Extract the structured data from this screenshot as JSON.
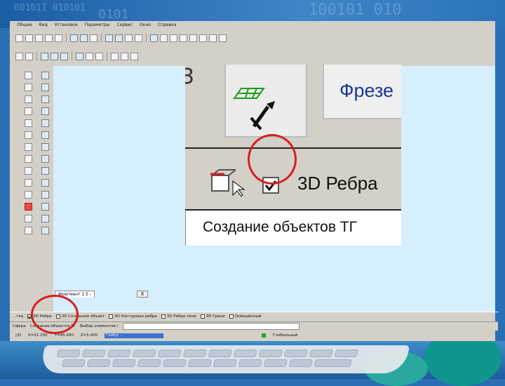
{
  "menu": [
    "Общие",
    "Вид",
    "Установки",
    "Параметры",
    "Сервис",
    "Окно",
    "Справка"
  ],
  "zoom": {
    "top_label": "Фрезе",
    "ribbon_checkbox_label": "3D Ребра",
    "ribbon_checked": true,
    "bottom_label": "Создание объектов ТГ"
  },
  "document_tab": "Фрагмент 2.5 -",
  "tab_close": "X",
  "checkbox_strip": [
    {
      "label": "...тка",
      "checked": false
    },
    {
      "label": "3D Ребра",
      "checked": true
    },
    {
      "label": "3D Сплошной объект",
      "checked": false
    },
    {
      "label": "3D Контурные ребра",
      "checked": false
    },
    {
      "label": "3D Ребра тени",
      "checked": false
    },
    {
      "label": "3D Грани",
      "checked": false
    },
    {
      "label": "Освещённый",
      "checked": false
    }
  ],
  "command_line": {
    "prefix": "Сфера ",
    "object_text": "Создание объектов ТГ",
    "mode_text": "Выбор элементов /"
  },
  "status_bar": {
    "left": "|/O",
    "coord_1": "X=11.150",
    "coord_2": "Y=45.000",
    "coord_3": "Z=5.000",
    "progress_text": "Глобус ...",
    "right_text": "Глобальный"
  },
  "colors": {
    "accent_red": "#d71f1f",
    "canvas_bg": "#d6efff",
    "window_bg": "#d4d0c8",
    "progress_blue": "#3a6fd1"
  }
}
